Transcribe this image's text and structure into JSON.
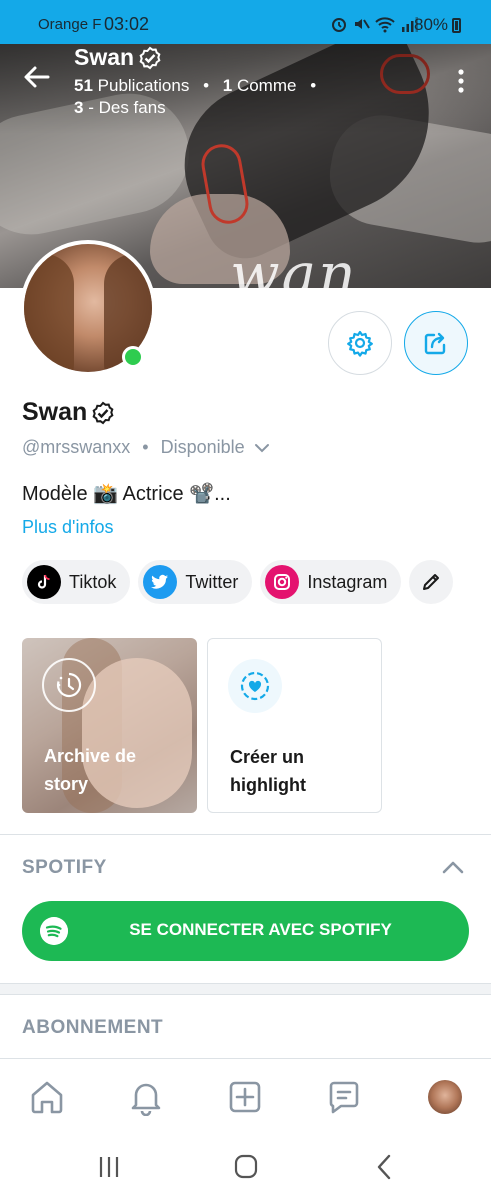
{
  "status_bar": {
    "carrier": "Orange F",
    "time": "03:02",
    "battery": "80%"
  },
  "header": {
    "name": "Swan",
    "publications_count": "51",
    "publications_label": "Publications",
    "comments_count": "1",
    "comments_label": "Comme",
    "fans_count": "3",
    "fans_label": "- Des fans"
  },
  "cover": {
    "scrawl": "wan"
  },
  "profile": {
    "name": "Swan",
    "handle": "@mrsswanxx",
    "availability": "Disponible",
    "bio": "Modèle 📸 Actrice 📽️...",
    "more_info": "Plus d'infos",
    "online": true
  },
  "social_links": [
    {
      "label": "Tiktok",
      "icon": "tiktok-icon",
      "color": "#000000"
    },
    {
      "label": "Twitter",
      "icon": "twitter-icon",
      "color": "#1d9bf0"
    },
    {
      "label": "Instagram",
      "icon": "instagram-icon",
      "color": "#e4136f"
    }
  ],
  "highlights": {
    "archive_label": "Archive de story",
    "create_label": "Créer un highlight"
  },
  "spotify": {
    "section_title": "SPOTIFY",
    "connect_label": "SE CONNECTER AVEC SPOTIFY",
    "color": "#1db954"
  },
  "subscription": {
    "section_title": "ABONNEMENT"
  },
  "bottom_nav": [
    "home-icon",
    "bell-icon",
    "add-post-icon",
    "messages-icon",
    "profile-avatar"
  ],
  "colors": {
    "accent": "#14a9e8",
    "muted": "#8a96a3",
    "online": "#2ecc4f"
  }
}
